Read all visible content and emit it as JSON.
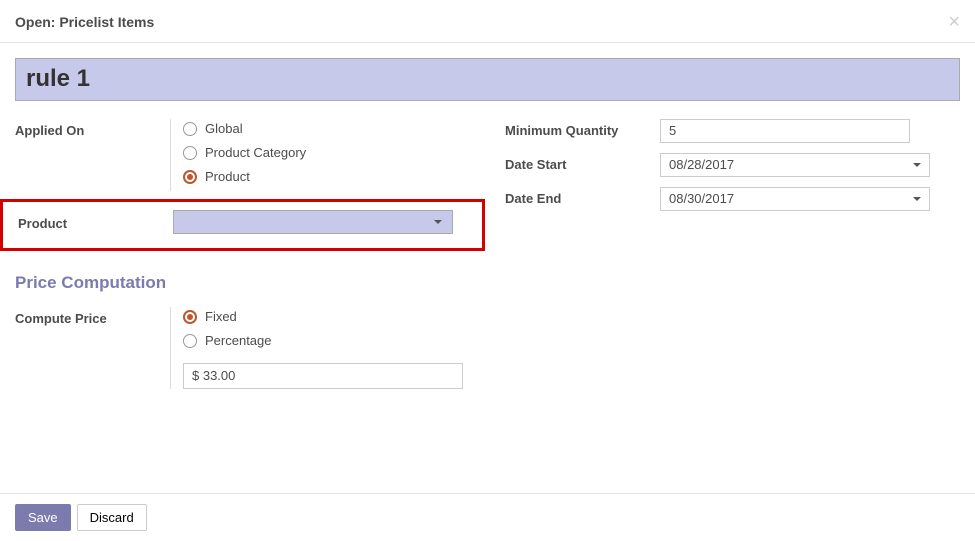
{
  "modal": {
    "title": "Open: Pricelist Items"
  },
  "rule": {
    "name": "rule 1"
  },
  "labels": {
    "applied_on": "Applied On",
    "product": "Product",
    "min_qty": "Minimum Quantity",
    "date_start": "Date Start",
    "date_end": "Date End",
    "compute_price": "Compute Price"
  },
  "applied_on": {
    "options": {
      "global": "Global",
      "category": "Product Category",
      "product": "Product"
    },
    "selected": "product"
  },
  "product_select": {
    "value": ""
  },
  "min_qty": "5",
  "date_start": "08/28/2017",
  "date_end": "08/30/2017",
  "section": {
    "price_computation": "Price Computation"
  },
  "compute_price": {
    "options": {
      "fixed": "Fixed",
      "percentage": "Percentage"
    },
    "selected": "fixed",
    "fixed_value": "$ 33.00"
  },
  "buttons": {
    "save": "Save",
    "discard": "Discard"
  }
}
